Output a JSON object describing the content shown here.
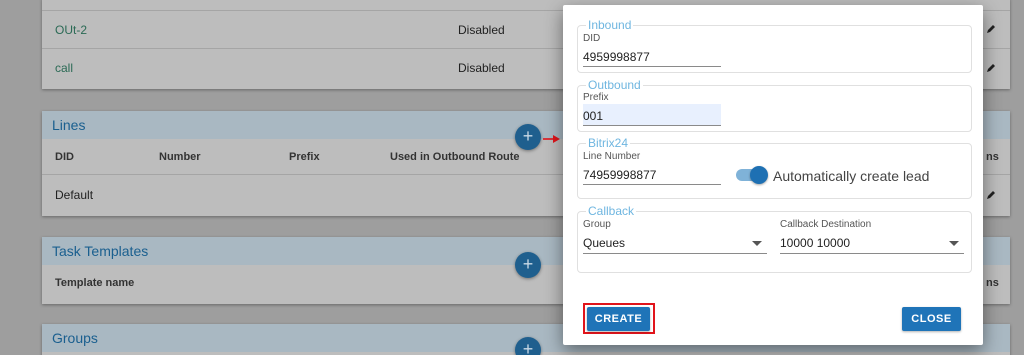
{
  "background": {
    "out_rows": [
      {
        "name": "OUt-2",
        "status": "Disabled"
      },
      {
        "name": "call",
        "status": "Disabled"
      }
    ],
    "lines": {
      "title": "Lines",
      "columns": [
        "DID",
        "Number",
        "Prefix",
        "Used in Outbound Route"
      ],
      "actions_header_fragment": "ns",
      "rows": [
        {
          "did": "Default"
        }
      ]
    },
    "task_templates": {
      "title": "Task Templates",
      "columns": [
        "Template name"
      ],
      "actions_header_fragment": "ns"
    },
    "groups": {
      "title": "Groups"
    },
    "add_icon": "+"
  },
  "dialog": {
    "inbound": {
      "legend": "Inbound",
      "did_label": "DID",
      "did_value": "4959998877"
    },
    "outbound": {
      "legend": "Outbound",
      "prefix_label": "Prefix",
      "prefix_value": "001"
    },
    "bitrix": {
      "legend": "Bitrix24",
      "line_number_label": "Line Number",
      "line_number_value": "74959998877",
      "auto_lead_label": "Automatically create lead",
      "auto_lead_enabled": true
    },
    "callback": {
      "legend": "Callback",
      "group_label": "Group",
      "group_value": "Queues",
      "destination_label": "Callback Destination",
      "destination_value": "10000 10000"
    },
    "create_label": "CREATE",
    "close_label": "CLOSE"
  },
  "colors": {
    "primary": "#1f74b8",
    "legend": "#6fb6e0",
    "highlight": "#e1141b"
  }
}
